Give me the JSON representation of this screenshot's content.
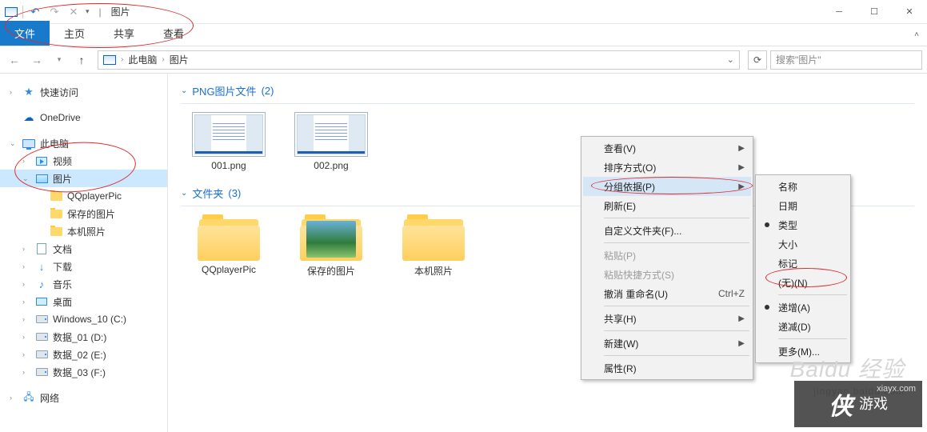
{
  "titlebar": {
    "title": "图片",
    "sep": "|"
  },
  "ribbon": {
    "file": "文件",
    "tabs": [
      "主页",
      "共享",
      "查看"
    ]
  },
  "address": {
    "crumbs": [
      "此电脑",
      "图片"
    ],
    "search_placeholder": "搜索\"图片\""
  },
  "nav": {
    "quick": "快速访问",
    "onedrive": "OneDrive",
    "thispc": "此电脑",
    "video": "视频",
    "pictures": "图片",
    "pic_children": [
      "QQplayerPic",
      "保存的图片",
      "本机照片"
    ],
    "documents": "文档",
    "downloads": "下载",
    "music": "音乐",
    "desktop": "桌面",
    "drives": [
      "Windows_10 (C:)",
      "数据_01 (D:)",
      "数据_02 (E:)",
      "数据_03 (F:)"
    ],
    "network": "网络"
  },
  "content": {
    "group1": {
      "label": "PNG图片文件",
      "count": "(2)",
      "files": [
        "001.png",
        "002.png"
      ]
    },
    "group2": {
      "label": "文件夹",
      "count": "(3)",
      "folders": [
        "QQplayerPic",
        "保存的图片",
        "本机照片"
      ]
    }
  },
  "ctx_main": [
    {
      "label": "查看(V)",
      "arrow": true
    },
    {
      "label": "排序方式(O)",
      "arrow": true
    },
    {
      "label": "分组依据(P)",
      "arrow": true,
      "hi": true
    },
    {
      "label": "刷新(E)"
    },
    {
      "sep": true
    },
    {
      "label": "自定义文件夹(F)..."
    },
    {
      "sep": true
    },
    {
      "label": "粘贴(P)",
      "dis": true
    },
    {
      "label": "粘贴快捷方式(S)",
      "dis": true
    },
    {
      "label": "撤消 重命名(U)",
      "shortcut": "Ctrl+Z"
    },
    {
      "sep": true
    },
    {
      "label": "共享(H)",
      "arrow": true
    },
    {
      "sep": true
    },
    {
      "label": "新建(W)",
      "arrow": true
    },
    {
      "sep": true
    },
    {
      "label": "属性(R)"
    }
  ],
  "ctx_sub": [
    {
      "label": "名称"
    },
    {
      "label": "日期"
    },
    {
      "label": "类型",
      "bullet": true
    },
    {
      "label": "大小"
    },
    {
      "label": "标记"
    },
    {
      "label": "(无)(N)"
    },
    {
      "sep": true
    },
    {
      "label": "递增(A)",
      "bullet": true
    },
    {
      "label": "递减(D)"
    },
    {
      "sep": true
    },
    {
      "label": "更多(M)..."
    }
  ],
  "wm": {
    "baidu": "Baidu 经验",
    "jy": "jingyan.baidu.com",
    "xia": "侠",
    "game": "游戏",
    "url": "xiayx.com"
  }
}
